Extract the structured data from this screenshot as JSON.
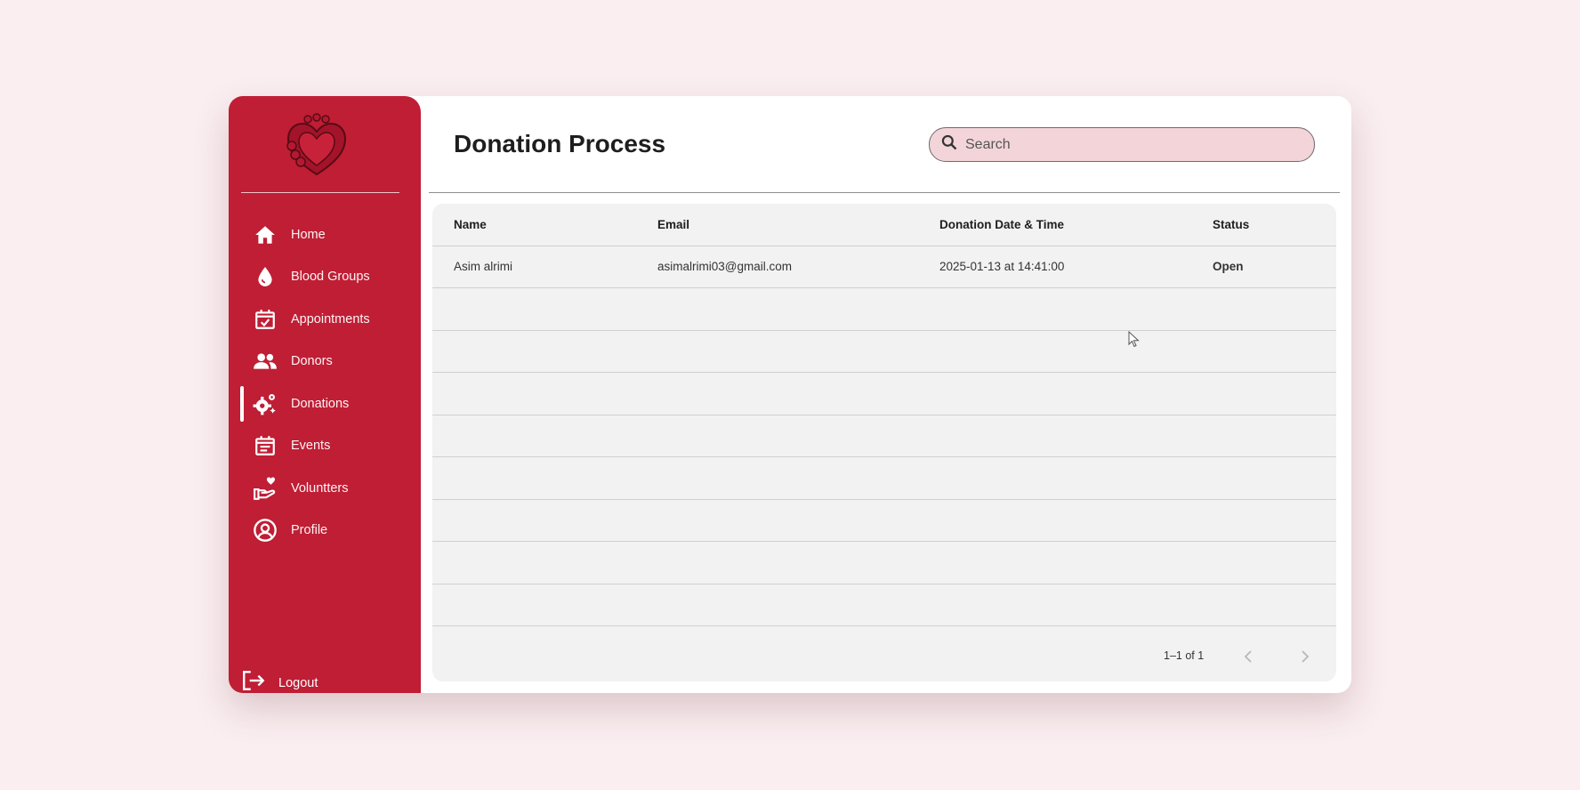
{
  "sidebar": {
    "items": [
      {
        "label": "Home",
        "icon": "home-icon"
      },
      {
        "label": "Blood Groups",
        "icon": "blood-drop-icon"
      },
      {
        "label": "Appointments",
        "icon": "calendar-check-icon"
      },
      {
        "label": "Donors",
        "icon": "people-icon"
      },
      {
        "label": "Donations",
        "icon": "gears-icon",
        "active": true
      },
      {
        "label": "Events",
        "icon": "event-calendar-icon"
      },
      {
        "label": "Voluntters",
        "icon": "hand-heart-icon"
      },
      {
        "label": "Profile",
        "icon": "profile-circle-icon"
      }
    ],
    "logout_label": "Logout"
  },
  "main": {
    "title": "Donation Process",
    "search": {
      "placeholder": "Search"
    }
  },
  "table": {
    "headers": [
      "Name",
      "Email",
      "Donation Date & Time",
      "Status"
    ],
    "rows": [
      {
        "name": "Asim alrimi",
        "email": "asimalrimi03@gmail.com",
        "datetime": "2025-01-13 at 14:41:00",
        "status": "Open"
      }
    ],
    "pagination": "1–1 of 1"
  },
  "colors": {
    "sidebar": "#bf1e35",
    "background": "#faeef0",
    "search_bg": "#f2d4d9",
    "table_bg": "#f2f2f2"
  }
}
